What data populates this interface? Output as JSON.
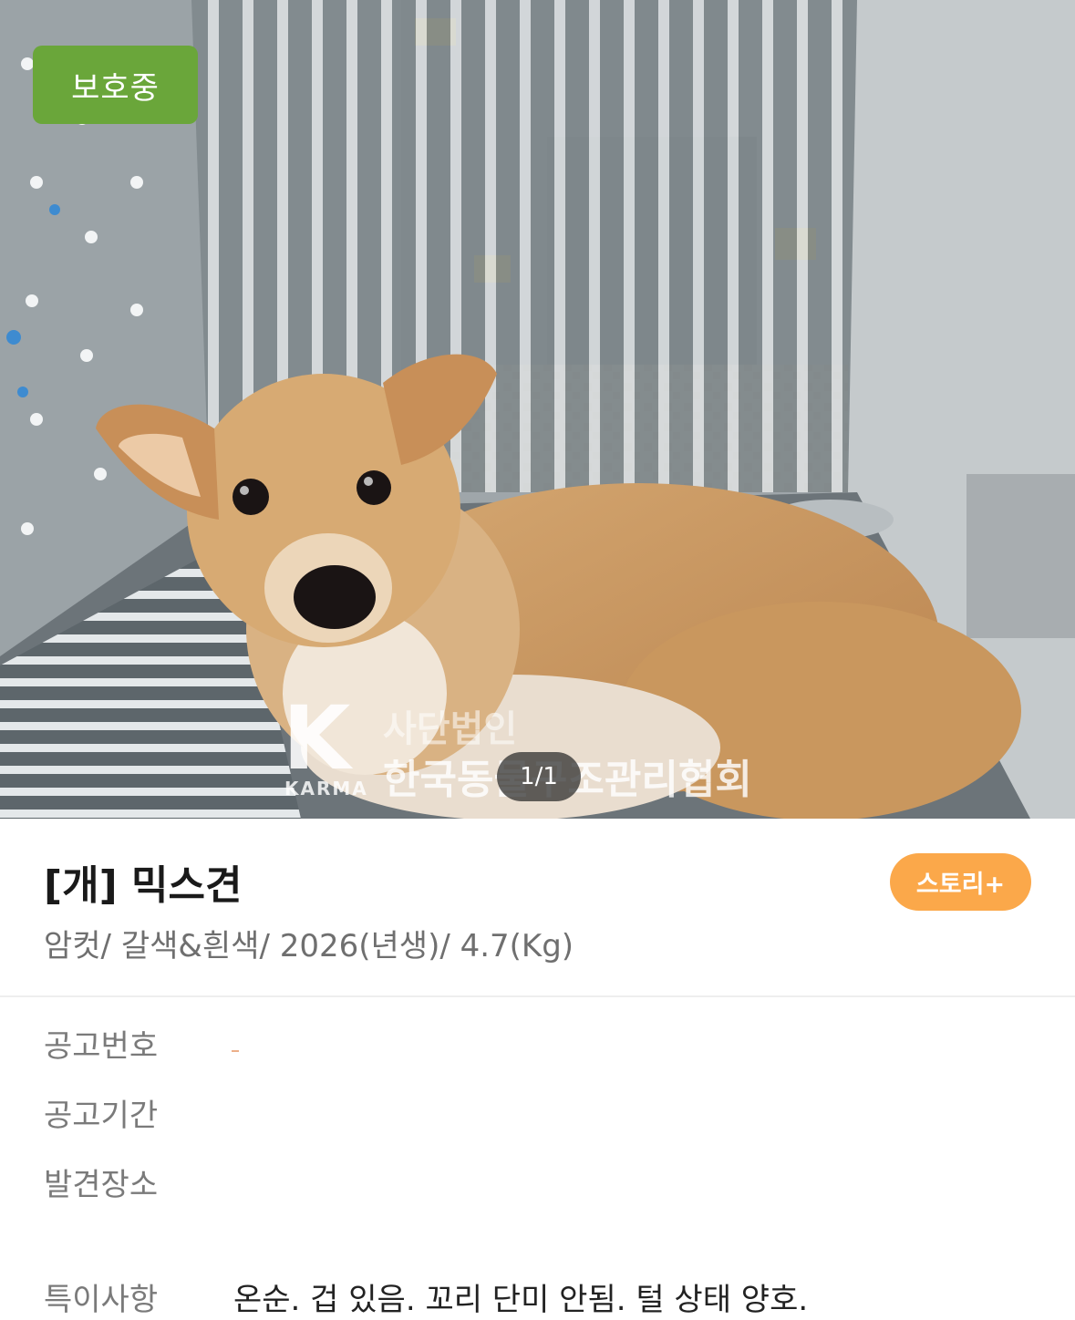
{
  "photo": {
    "status_badge": "보호중",
    "page_indicator": "1/1",
    "watermark": {
      "logo_letter": "K",
      "logo_text": "KARMA",
      "line1": "사단법인",
      "line2": "한국동물구조관리협회"
    }
  },
  "animal": {
    "title": "[개] 믹스견",
    "details": "암컷/ 갈색&흰색/ 2026(년생)/ 4.7(Kg)",
    "story_button": "스토리+"
  },
  "info": {
    "rows": [
      {
        "label": "공고번호",
        "value": ""
      },
      {
        "label": "공고기간",
        "value": ""
      },
      {
        "label": "발견장소",
        "value": ""
      },
      {
        "label": "특이사항",
        "value": "온순. 겁 있음. 꼬리 단미 안됨. 털 상태 양호."
      }
    ]
  },
  "colors": {
    "status_green": "#6aa63a",
    "story_orange": "#fba84a"
  }
}
